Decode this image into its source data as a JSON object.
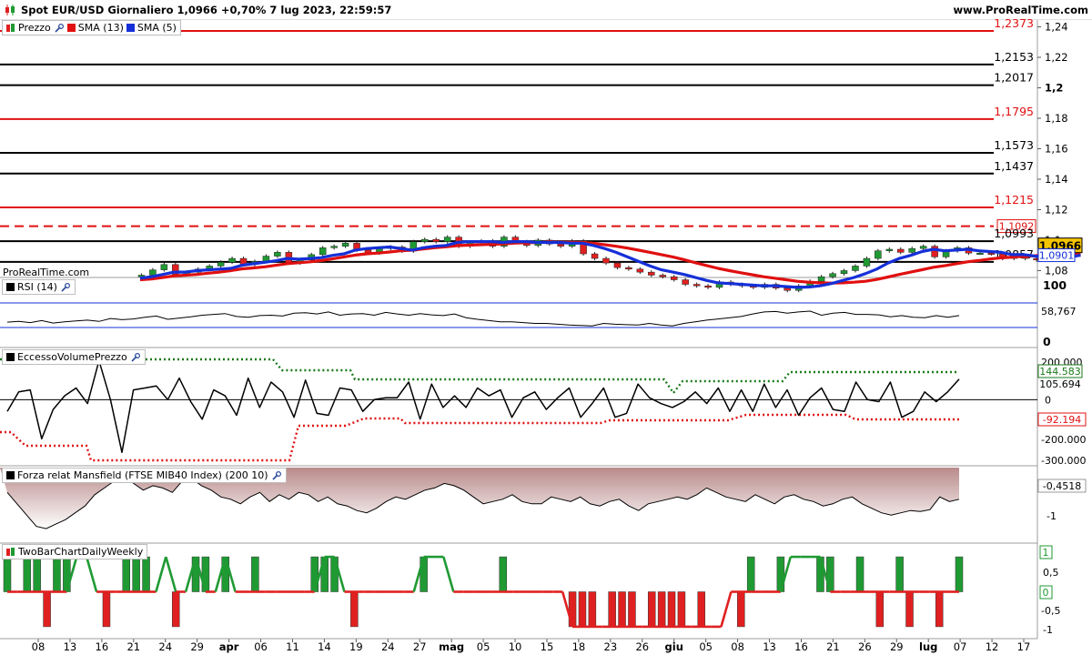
{
  "header": {
    "title": "Spot EUR/USD Giornaliero 1,0966 +0,70% 7 lug 2023, 22:59:57",
    "site": "www.ProRealTime.com"
  },
  "watermark": "ProRealTime.com",
  "panels": {
    "price": {
      "label": "Prezzo",
      "sma13": "SMA (13)",
      "sma5": "SMA (5)"
    },
    "rsi": {
      "label": "RSI (14)"
    },
    "evp": {
      "label": "EccessoVolumePrezzo"
    },
    "mansfield": {
      "label": "Forza relat Mansfield (FTSE MIB40 Index) (200 10)"
    },
    "twobar": {
      "label": "TwoBarChartDailyWeekly"
    }
  },
  "colors": {
    "up": "#1f9a33",
    "down": "#e02020",
    "sma13": "#e01010",
    "sma5": "#1530d8",
    "level_black": "#000000",
    "level_red": "#e01010",
    "current": "#f5c400"
  },
  "chart_data": [
    {
      "type": "candlestick",
      "title": "Spot EUR/USD Giornaliero",
      "ylim": [
        1.0755,
        1.2445
      ],
      "y_ticks": [
        "1,24",
        "1,22",
        "1,2",
        "1,18",
        "1,16",
        "1,14",
        "1,12",
        "1,1",
        "1,08"
      ],
      "x_ticks": [
        "08",
        "13",
        "16",
        "21",
        "24",
        "29",
        "apr",
        "06",
        "11",
        "14",
        "19",
        "24",
        "27",
        "mag",
        "05",
        "10",
        "15",
        "18",
        "23",
        "26",
        "giu",
        "05",
        "08",
        "13",
        "16",
        "21",
        "26",
        "29",
        "lug",
        "07",
        "12",
        "17"
      ],
      "x_ticks_bold": [
        "apr",
        "mag",
        "giu",
        "lug"
      ],
      "levels": [
        {
          "value": 1.2373,
          "label": "1,2373",
          "color": "red",
          "style": "solid"
        },
        {
          "value": 1.2153,
          "label": "1,2153",
          "color": "black",
          "style": "solid"
        },
        {
          "value": 1.2017,
          "label": "1,2017",
          "color": "black",
          "style": "solid"
        },
        {
          "value": 1.1795,
          "label": "1,1795",
          "color": "red",
          "style": "solid"
        },
        {
          "value": 1.1573,
          "label": "1,1573",
          "color": "black",
          "style": "solid"
        },
        {
          "value": 1.1437,
          "label": "1,1437",
          "color": "black",
          "style": "solid"
        },
        {
          "value": 1.1215,
          "label": "1,1215",
          "color": "red",
          "style": "solid"
        },
        {
          "value": 1.1092,
          "label": "1,1092",
          "color": "red",
          "style": "dashed"
        },
        {
          "value": 1.0993,
          "label": "1,0993",
          "color": "black",
          "style": "solid"
        },
        {
          "value": 1.0857,
          "label": "1,0857",
          "color": "black",
          "style": "solid"
        }
      ],
      "current_price": {
        "value": 1.0966,
        "label": "1,0966"
      },
      "sma5_last": {
        "value": 1.0901,
        "label": "1,0901"
      },
      "closes": [
        1.076,
        1.077,
        1.0805,
        1.084,
        1.0775,
        1.079,
        1.081,
        1.083,
        1.0855,
        1.088,
        1.084,
        1.086,
        1.0895,
        1.092,
        1.085,
        1.087,
        1.0905,
        1.095,
        1.096,
        1.098,
        1.0935,
        1.0915,
        1.0945,
        1.0955,
        1.0928,
        1.099,
        1.1005,
        1.099,
        1.102,
        1.096,
        1.0985,
        1.0995,
        1.096,
        1.102,
        1.099,
        1.0965,
        1.1,
        1.0975,
        1.096,
        1.0995,
        1.091,
        1.088,
        1.085,
        1.082,
        1.081,
        1.079,
        1.077,
        1.076,
        1.074,
        1.071,
        1.07,
        1.069,
        1.0725,
        1.071,
        1.07,
        1.069,
        1.071,
        1.0685,
        1.067,
        1.07,
        1.073,
        1.076,
        1.078,
        1.08,
        1.083,
        1.088,
        1.093,
        1.094,
        1.092,
        1.0945,
        1.096,
        1.089,
        1.093,
        1.095,
        1.0915,
        1.0915,
        1.091,
        1.088,
        1.09,
        1.088,
        1.087,
        1.09,
        1.0885,
        1.0966
      ],
      "sma13": [
        1.074,
        1.0745,
        1.0755,
        1.0765,
        1.077,
        1.0775,
        1.0783,
        1.079,
        1.08,
        1.0812,
        1.0818,
        1.0825,
        1.0835,
        1.0846,
        1.0852,
        1.0858,
        1.0866,
        1.0878,
        1.089,
        1.0902,
        1.091,
        1.0915,
        1.0922,
        1.093,
        1.0934,
        1.0942,
        1.095,
        1.0956,
        1.0964,
        1.0967,
        1.097,
        1.0973,
        1.0975,
        1.098,
        1.0983,
        1.0984,
        1.0987,
        1.0987,
        1.0986,
        1.0985,
        1.0979,
        1.097,
        1.096,
        1.0948,
        1.0934,
        1.092,
        1.0905,
        1.089,
        1.0872,
        1.0852,
        1.0833,
        1.0815,
        1.08,
        1.0786,
        1.0773,
        1.076,
        1.075,
        1.074,
        1.073,
        1.0724,
        1.072,
        1.0718,
        1.072,
        1.0724,
        1.073,
        1.0742,
        1.0758,
        1.0775,
        1.079,
        1.0806,
        1.0822,
        1.0832,
        1.0845,
        1.0858,
        1.0866,
        1.0876,
        1.0884,
        1.0888,
        1.0894,
        1.0898,
        1.09,
        1.0905,
        1.0906,
        1.0912
      ],
      "sma5": [
        1.075,
        1.076,
        1.0775,
        1.079,
        1.079,
        1.08,
        1.0805,
        1.081,
        1.0815,
        1.0835,
        1.0845,
        1.0855,
        1.0865,
        1.088,
        1.0875,
        1.088,
        1.0885,
        1.09,
        1.091,
        1.0935,
        1.0945,
        1.095,
        1.0955,
        1.0945,
        1.0935,
        1.095,
        1.096,
        1.0965,
        1.0985,
        1.099,
        1.099,
        1.099,
        1.0985,
        1.099,
        1.099,
        1.0985,
        1.0985,
        1.0985,
        1.098,
        1.098,
        1.0965,
        1.0945,
        1.092,
        1.089,
        1.086,
        1.083,
        1.0805,
        1.079,
        1.0775,
        1.0755,
        1.0735,
        1.072,
        1.0715,
        1.071,
        1.0705,
        1.07,
        1.07,
        1.0695,
        1.069,
        1.0692,
        1.07,
        1.0715,
        1.0735,
        1.0755,
        1.078,
        1.081,
        1.085,
        1.088,
        1.09,
        1.0925,
        1.094,
        1.093,
        1.0935,
        1.094,
        1.093,
        1.0925,
        1.092,
        1.0905,
        1.0905,
        1.0895,
        1.089,
        1.089,
        1.0888,
        1.0901
      ]
    },
    {
      "type": "line",
      "title": "RSI (14)",
      "ylim": [
        0,
        100
      ],
      "y_ticks": [
        "100",
        "0"
      ],
      "last": "58,767",
      "values": [
        43,
        45,
        42,
        47,
        41,
        44,
        46,
        48,
        45,
        52,
        49,
        51,
        55,
        58,
        50,
        53,
        56,
        60,
        62,
        64,
        57,
        55,
        59,
        60,
        58,
        65,
        66,
        63,
        68,
        60,
        63,
        64,
        60,
        67,
        63,
        60,
        64,
        61,
        59,
        63,
        54,
        50,
        47,
        44,
        44,
        42,
        40,
        40,
        38,
        36,
        35,
        34,
        40,
        38,
        37,
        36,
        40,
        36,
        34,
        40,
        44,
        48,
        51,
        54,
        57,
        63,
        68,
        69,
        65,
        68,
        70,
        60,
        65,
        67,
        62,
        62,
        61,
        56,
        59,
        55,
        54,
        59,
        55,
        59
      ]
    },
    {
      "type": "line",
      "title": "EccessoVolumePrezzo",
      "ylim": [
        -320000,
        230000
      ],
      "y_ticks": [
        "200.000",
        "0",
        "-200.000",
        "-300.000"
      ],
      "labels": {
        "upper": "144.583",
        "value": "105.694",
        "lower": "-92.194"
      },
      "values": [
        -60000,
        40000,
        50000,
        -200000,
        -50000,
        20000,
        60000,
        -20000,
        200000,
        0,
        -270000,
        50000,
        60000,
        70000,
        0,
        110000,
        -10000,
        -100000,
        50000,
        20000,
        -80000,
        110000,
        -40000,
        90000,
        40000,
        -90000,
        100000,
        -70000,
        -80000,
        60000,
        50000,
        -60000,
        0,
        10000,
        10000,
        90000,
        -100000,
        80000,
        -40000,
        20000,
        -40000,
        60000,
        20000,
        50000,
        -90000,
        10000,
        40000,
        -50000,
        10000,
        60000,
        -90000,
        -20000,
        60000,
        -90000,
        -70000,
        80000,
        10000,
        -20000,
        -40000,
        -10000,
        40000,
        -20000,
        60000,
        -60000,
        50000,
        -60000,
        80000,
        -40000,
        50000,
        -80000,
        10000,
        60000,
        -50000,
        -60000,
        90000,
        0,
        -10000,
        90000,
        -90000,
        -60000,
        40000,
        -10000,
        40000,
        105694
      ],
      "upper": [
        130000,
        130000,
        130000,
        130000,
        130000,
        130000,
        130000,
        130000,
        130000,
        130000,
        130000,
        130000,
        130000,
        130000,
        130000,
        130000,
        130000,
        130000,
        130000,
        130000,
        130000,
        130000,
        130000,
        130000,
        130000,
        130000,
        130000,
        130000,
        130000,
        130000,
        130000,
        130000,
        130000,
        130000,
        130000,
        130000,
        130000,
        130000,
        130000,
        130000,
        130000,
        130000,
        130000,
        130000,
        130000,
        130000,
        130000,
        130000,
        130000,
        130000,
        130000,
        130000,
        130000,
        130000,
        130000,
        130000,
        130000,
        130000,
        130000,
        130000,
        130000,
        130000,
        130000,
        130000,
        130000,
        130000,
        130000,
        130000,
        130000,
        130000,
        130000,
        130000,
        130000,
        130000,
        130000,
        130000,
        130000,
        130000,
        130000,
        130000,
        130000,
        130000,
        130000,
        130000
      ],
      "lower": [
        -92194
      ]
    },
    {
      "type": "area",
      "title": "Forza relat Mansfield (FTSE MIB40 Index) (200 10)",
      "ylim": [
        -1.4,
        0.25
      ],
      "y_ticks": [
        "-0,4518",
        "-1"
      ],
      "last": "-0,4518",
      "values": [
        -0.3,
        -0.55,
        -0.8,
        -1.05,
        -1.1,
        -1.0,
        -0.9,
        -0.75,
        -0.6,
        -0.35,
        -0.2,
        -0.05,
        0.05,
        -0.1,
        -0.25,
        -0.15,
        -0.2,
        -0.3,
        -0.05,
        0.0,
        -0.15,
        -0.25,
        -0.4,
        -0.45,
        -0.55,
        -0.4,
        -0.3,
        -0.5,
        -0.35,
        -0.45,
        -0.3,
        -0.35,
        -0.5,
        -0.4,
        -0.55,
        -0.6,
        -0.7,
        -0.75,
        -0.65,
        -0.5,
        -0.4,
        -0.45,
        -0.35,
        -0.25,
        -0.2,
        -0.1,
        -0.15,
        -0.25,
        -0.4,
        -0.55,
        -0.5,
        -0.45,
        -0.35,
        -0.5,
        -0.55,
        -0.55,
        -0.4,
        -0.45,
        -0.5,
        -0.4,
        -0.55,
        -0.6,
        -0.5,
        -0.45,
        -0.6,
        -0.7,
        -0.55,
        -0.5,
        -0.45,
        -0.4,
        -0.45,
        -0.35,
        -0.2,
        -0.3,
        -0.4,
        -0.45,
        -0.5,
        -0.35,
        -0.45,
        -0.55,
        -0.4,
        -0.35,
        -0.45,
        -0.5,
        -0.6,
        -0.55,
        -0.45,
        -0.4,
        -0.55,
        -0.65,
        -0.75,
        -0.8,
        -0.75,
        -0.7,
        -0.72,
        -0.68,
        -0.4,
        -0.5,
        -0.45
      ]
    },
    {
      "type": "bar",
      "title": "TwoBarChartDailyWeekly",
      "ylim": [
        -1.15,
        1.15
      ],
      "y_ticks": [
        "1",
        "0,5",
        "0",
        "-0,5",
        "-1"
      ],
      "last_labels": [
        "1",
        "0"
      ],
      "daily": [
        1,
        0,
        1,
        1,
        -1,
        1,
        1,
        0,
        0,
        0,
        -1,
        0,
        1,
        1,
        1,
        0,
        0,
        -1,
        0,
        1,
        1,
        0,
        1,
        0,
        0,
        1,
        0,
        0,
        0,
        0,
        0,
        1,
        1,
        1,
        0,
        -1,
        0,
        0,
        0,
        0,
        0,
        0,
        1,
        0,
        0,
        0,
        0,
        0,
        0,
        0,
        1,
        0,
        0,
        0,
        0,
        0,
        0,
        -1,
        -1,
        -1,
        0,
        -1,
        -1,
        -1,
        0,
        -1,
        -1,
        -1,
        -1,
        0,
        -1,
        0,
        0,
        0,
        -1,
        1,
        0,
        0,
        1,
        0,
        0,
        0,
        1,
        1,
        0,
        0,
        1,
        0,
        -1,
        0,
        1,
        -1,
        0,
        0,
        -1,
        0,
        1
      ],
      "weekly": [
        0,
        0,
        0,
        0,
        0,
        0,
        0,
        1,
        1,
        0,
        0,
        0,
        0,
        0,
        0,
        0,
        1,
        0,
        0,
        1,
        0,
        0,
        1,
        0,
        0,
        0,
        0,
        0,
        0,
        0,
        0,
        0,
        1,
        1,
        0,
        0,
        0,
        0,
        0,
        0,
        0,
        0,
        1,
        1,
        1,
        0,
        0,
        0,
        0,
        0,
        0,
        0,
        0,
        0,
        0,
        0,
        0,
        -1,
        -1,
        -1,
        -1,
        -1,
        -1,
        -1,
        -1,
        -1,
        -1,
        -1,
        -1,
        -1,
        -1,
        -1,
        -1,
        0,
        0,
        0,
        0,
        0,
        0,
        1,
        1,
        1,
        1,
        0,
        0,
        0,
        0,
        0,
        0,
        0,
        0,
        0,
        0,
        0,
        0,
        0,
        0
      ]
    }
  ]
}
